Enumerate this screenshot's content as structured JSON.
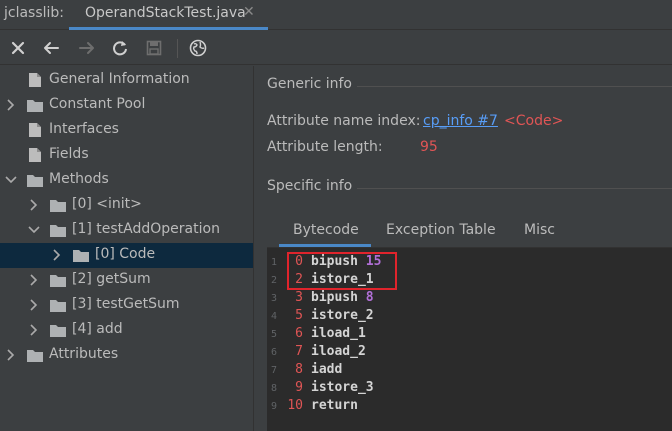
{
  "app": {
    "name": "jclasslib:"
  },
  "tab": {
    "label": "OperandStackTest.java",
    "close": "✕"
  },
  "toolbar": {
    "buttons": [
      "close-icon",
      "back-icon",
      "forward-icon",
      "refresh-icon",
      "save-icon",
      "browser-icon"
    ],
    "accent": "#4a88c7"
  },
  "tree": {
    "general_information": "General Information",
    "constant_pool": "Constant Pool",
    "interfaces": "Interfaces",
    "fields": "Fields",
    "methods": "Methods",
    "m0": "[0] <init>",
    "m1": "[1] testAddOperation",
    "m1_code": "[0] Code",
    "m2": "[2] getSum",
    "m3": "[3] testGetSum",
    "m4": "[4] add",
    "attributes": "Attributes"
  },
  "generic": {
    "title": "Generic info",
    "name_index_label": "Attribute name index:",
    "name_index_link": "cp_info #7",
    "name_index_value": "<Code>",
    "length_label": "Attribute length:",
    "length_value": "95"
  },
  "specific": {
    "title": "Specific info"
  },
  "bytecode_tabs": {
    "bytecode": "Bytecode",
    "exception_table": "Exception Table",
    "misc": "Misc"
  },
  "code": {
    "lines": [
      {
        "ln": "1",
        "offset": "0",
        "op": "bipush",
        "arg": "15"
      },
      {
        "ln": "2",
        "offset": "2",
        "op": "istore_1",
        "arg": ""
      },
      {
        "ln": "3",
        "offset": "3",
        "op": "bipush",
        "arg": "8"
      },
      {
        "ln": "4",
        "offset": "5",
        "op": "istore_2",
        "arg": ""
      },
      {
        "ln": "5",
        "offset": "6",
        "op": "iload_1",
        "arg": ""
      },
      {
        "ln": "6",
        "offset": "7",
        "op": "iload_2",
        "arg": ""
      },
      {
        "ln": "7",
        "offset": "8",
        "op": "iadd",
        "arg": ""
      },
      {
        "ln": "8",
        "offset": "9",
        "op": "istore_3",
        "arg": ""
      },
      {
        "ln": "9",
        "offset": "10",
        "op": "return",
        "arg": ""
      }
    ]
  }
}
